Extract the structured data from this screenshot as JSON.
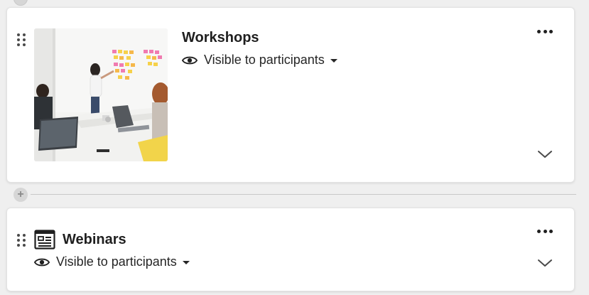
{
  "sections": [
    {
      "title": "Workshops",
      "visibility_label": "Visible to participants",
      "thumbnail_alt": "",
      "icon": "image-thumbnail"
    },
    {
      "title": "Webinars",
      "visibility_label": "Visible to participants",
      "icon": "page-icon"
    }
  ],
  "icons": {
    "drag": "drag-handle-icon",
    "visibility": "eye-icon",
    "menu": "more-horizontal-icon",
    "expand": "chevron-down-icon",
    "add": "plus-icon"
  },
  "add_label": "+",
  "colors": {
    "background": "#efefef",
    "card": "#ffffff",
    "text": "#1f1f1f",
    "divider": "#c9c9c9"
  }
}
